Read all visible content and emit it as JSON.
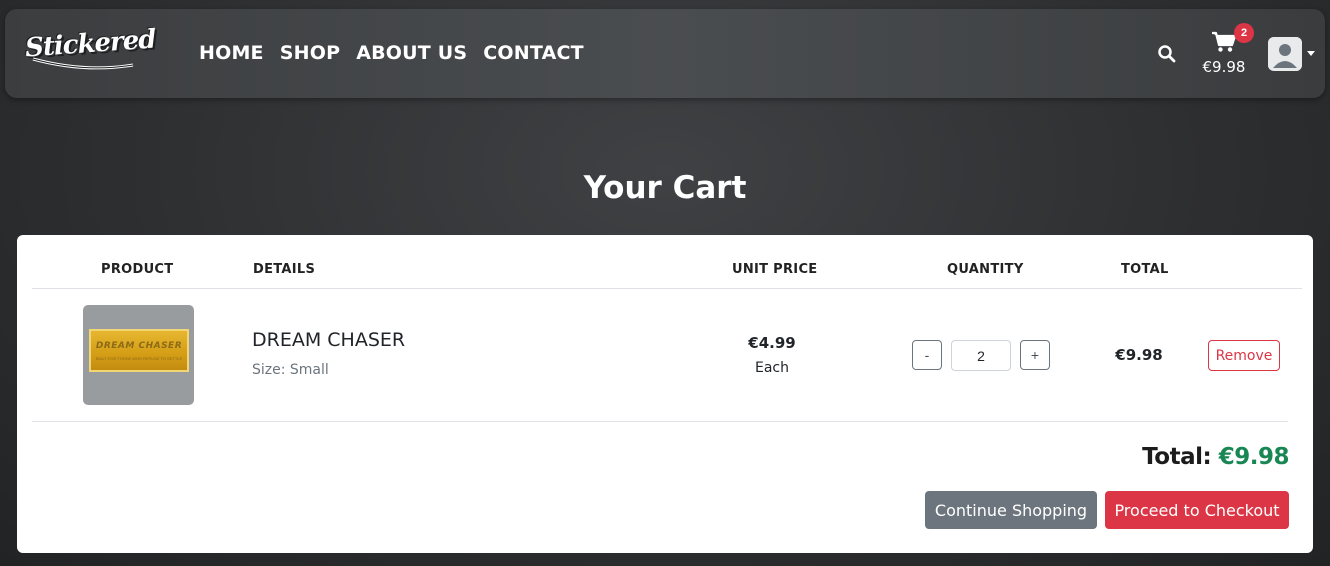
{
  "brand": {
    "logo_text": "Stickered"
  },
  "nav": {
    "links": [
      "HOME",
      "SHOP",
      "ABOUT US",
      "CONTACT"
    ],
    "cart_count": "2",
    "cart_amount": "€9.98"
  },
  "page": {
    "title": "Your Cart"
  },
  "table": {
    "headers": {
      "product": "PRODUCT",
      "details": "DETAILS",
      "unit_price": "UNIT PRICE",
      "quantity": "QUANTITY",
      "total": "TOTAL"
    },
    "rows": [
      {
        "name": "DREAM CHASER",
        "size": "Size: Small",
        "unit_price": "€4.99",
        "unit_each": "Each",
        "quantity": "2",
        "total": "€9.98",
        "minus_label": "-",
        "plus_label": "+",
        "remove_label": "Remove",
        "sticker_title": "DREAM CHASER",
        "sticker_sub": "BUILT FOR THOSE WHO REFUSE TO SETTLE"
      }
    ]
  },
  "summary": {
    "total_label": "Total:",
    "total_amount": "€9.98"
  },
  "actions": {
    "continue_label": "Continue Shopping",
    "checkout_label": "Proceed to Checkout"
  },
  "colors": {
    "accent_red": "#dc3545",
    "accent_green": "#198754",
    "secondary_gray": "#6c757d"
  }
}
